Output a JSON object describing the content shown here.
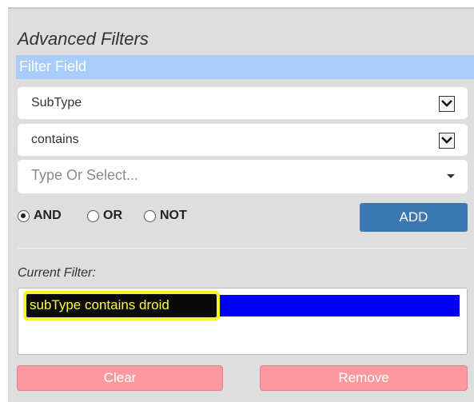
{
  "panel": {
    "title": "Advanced Filters",
    "field_header": "Filter Field",
    "field_select": {
      "value": "SubType"
    },
    "operator_select": {
      "value": "contains"
    },
    "value_input": {
      "placeholder": "Type Or Select..."
    },
    "logic_options": [
      {
        "label": "AND",
        "checked": true
      },
      {
        "label": "OR",
        "checked": false
      },
      {
        "label": "NOT",
        "checked": false
      }
    ],
    "add_label": "ADD",
    "current_filter_label": "Current Filter:",
    "current_filters": [
      "subType contains droid"
    ],
    "clear_label": "Clear",
    "remove_label": "Remove"
  },
  "colors": {
    "panel_bg": "#dedede",
    "header_bg": "#a9cdfa",
    "add_button": "#3b78b3",
    "selected_filter_bg": "#0000f5",
    "highlight": "#f4f428",
    "danger_button": "#fa9a9e"
  },
  "icons": {
    "select_toggle": "chevron-down-icon",
    "input_caret": "caret-down-icon",
    "radio": "radio-icon"
  }
}
